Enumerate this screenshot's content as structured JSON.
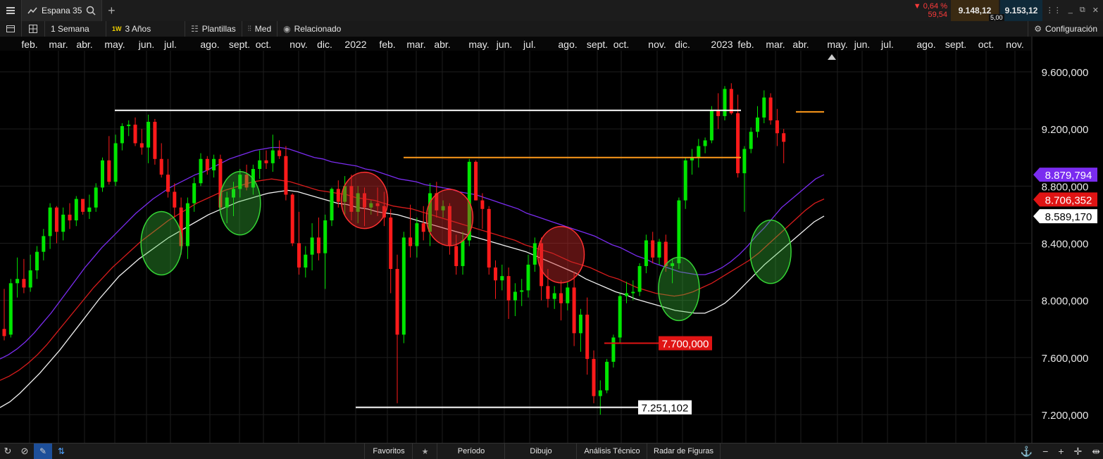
{
  "topbar": {
    "instrument": "Espana 35",
    "change_pct": "▼ 0,64 %",
    "change_pts": "59,54",
    "bid": "9.148,12",
    "ask": "9.153,12",
    "spread": "5,00"
  },
  "toolbar": {
    "interval": "1 Semana",
    "interval_badge": "1W",
    "range": "3 Años",
    "templates": "Plantillas",
    "price_type": "Med",
    "related": "Relacionado",
    "config": "Configuración"
  },
  "bottombar": {
    "favorites": "Favoritos",
    "period": "Período",
    "drawing": "Dibujo",
    "technical": "Análisis Técnico",
    "patterns": "Radar de Figuras"
  },
  "colors": {
    "up": "#00e600",
    "down": "#ff1a1a",
    "ma_fast": "#7a2cf0",
    "ma_mid": "#d81c1c",
    "ma_slow": "#f2f2f2",
    "accent_orange": "#ff9a1a"
  },
  "chart_data": {
    "type": "candlestick",
    "instrument": "Espana 35",
    "interval": "weekly",
    "x_tick_labels": [
      "feb.",
      "mar.",
      "abr.",
      "may.",
      "jun.",
      "jul.",
      "ago.",
      "sept.",
      "oct.",
      "nov.",
      "dic.",
      "2022",
      "feb.",
      "mar.",
      "abr.",
      "may.",
      "jun.",
      "jul.",
      "ago.",
      "sept.",
      "oct.",
      "nov.",
      "dic.",
      "2023",
      "feb.",
      "mar.",
      "abr.",
      "may.",
      "jun.",
      "jul.",
      "ago.",
      "sept.",
      "oct.",
      "nov."
    ],
    "y_ticks": [
      "9.600,000",
      "9.200,000",
      "8.800,000",
      "8.400,000",
      "8.000,000",
      "7.600,000",
      "7.200,000"
    ],
    "y_tick_values": [
      9600,
      9200,
      8800,
      8400,
      8000,
      7600,
      7200
    ],
    "ylim": [
      7100,
      9800
    ],
    "grid": true,
    "candles": [
      [
        7800,
        8080,
        7720,
        7750
      ],
      [
        7760,
        8150,
        7740,
        8120
      ],
      [
        8120,
        8300,
        8020,
        8150
      ],
      [
        8150,
        8290,
        8050,
        8090
      ],
      [
        8090,
        8320,
        8060,
        8210
      ],
      [
        8210,
        8380,
        8150,
        8340
      ],
      [
        8340,
        8500,
        8280,
        8450
      ],
      [
        8450,
        8680,
        8360,
        8650
      ],
      [
        8650,
        8660,
        8400,
        8480
      ],
      [
        8480,
        8650,
        8420,
        8600
      ],
      [
        8600,
        8680,
        8500,
        8560
      ],
      [
        8560,
        8730,
        8520,
        8710
      ],
      [
        8710,
        8660,
        8600,
        8620
      ],
      [
        8620,
        8740,
        8570,
        8650
      ],
      [
        8650,
        8820,
        8620,
        8790
      ],
      [
        8790,
        9000,
        8760,
        8980
      ],
      [
        8980,
        9150,
        8810,
        8830
      ],
      [
        8830,
        9160,
        8800,
        9100
      ],
      [
        9100,
        9240,
        9050,
        9220
      ],
      [
        9220,
        9260,
        9150,
        9230
      ],
      [
        9230,
        9280,
        9080,
        9100
      ],
      [
        9100,
        9200,
        9020,
        9070
      ],
      [
        9070,
        9300,
        8960,
        9250
      ],
      [
        9250,
        9270,
        8950,
        8990
      ],
      [
        8990,
        9100,
        8860,
        8880
      ],
      [
        8880,
        8990,
        8720,
        8760
      ],
      [
        8760,
        8820,
        8580,
        8650
      ],
      [
        8650,
        8720,
        8320,
        8380
      ],
      [
        8380,
        8720,
        8290,
        8680
      ],
      [
        8680,
        8860,
        8620,
        8820
      ],
      [
        8820,
        9030,
        8800,
        8990
      ],
      [
        8990,
        9010,
        8880,
        8910
      ],
      [
        8910,
        9020,
        8860,
        8990
      ],
      [
        8990,
        9020,
        8620,
        8650
      ],
      [
        8650,
        8760,
        8540,
        8720
      ],
      [
        8720,
        8830,
        8590,
        8780
      ],
      [
        8780,
        8920,
        8720,
        8880
      ],
      [
        8880,
        8950,
        8770,
        8790
      ],
      [
        8790,
        8950,
        8740,
        8920
      ],
      [
        8920,
        9050,
        8850,
        8980
      ],
      [
        8980,
        9050,
        8920,
        8960
      ],
      [
        8960,
        9160,
        8900,
        9050
      ],
      [
        9050,
        9120,
        8990,
        9010
      ],
      [
        9010,
        9080,
        8700,
        8740
      ],
      [
        8740,
        8750,
        8380,
        8400
      ],
      [
        8400,
        8620,
        8180,
        8230
      ],
      [
        8230,
        8380,
        8160,
        8320
      ],
      [
        8320,
        8540,
        8210,
        8440
      ],
      [
        8440,
        8580,
        8280,
        8330
      ],
      [
        8330,
        8600,
        8080,
        8560
      ],
      [
        8560,
        8790,
        8520,
        8780
      ],
      [
        8780,
        8840,
        8650,
        8690
      ],
      [
        8690,
        8870,
        8600,
        8800
      ],
      [
        8800,
        8880,
        8560,
        8620
      ],
      [
        8620,
        8800,
        8540,
        8750
      ],
      [
        8750,
        8790,
        8520,
        8650
      ],
      [
        8650,
        8700,
        8600,
        8680
      ],
      [
        8680,
        8790,
        8590,
        8660
      ],
      [
        8660,
        8760,
        8520,
        8580
      ],
      [
        8580,
        8640,
        8050,
        8220
      ],
      [
        8220,
        8320,
        7280,
        7760
      ],
      [
        7760,
        8480,
        7700,
        8440
      ],
      [
        8440,
        8670,
        8300,
        8380
      ],
      [
        8380,
        8580,
        8300,
        8540
      ],
      [
        8540,
        8660,
        8420,
        8480
      ],
      [
        8480,
        8820,
        8380,
        8750
      ],
      [
        8750,
        8830,
        8580,
        8630
      ],
      [
        8630,
        8700,
        8580,
        8660
      ],
      [
        8660,
        8680,
        8320,
        8380
      ],
      [
        8380,
        8460,
        8180,
        8240
      ],
      [
        8240,
        8480,
        8180,
        8420
      ],
      [
        8420,
        8990,
        8380,
        8970
      ],
      [
        8970,
        8980,
        8700,
        8700
      ],
      [
        8700,
        8750,
        8500,
        8640
      ],
      [
        8640,
        8660,
        8180,
        8230
      ],
      [
        8230,
        8280,
        8010,
        8140
      ],
      [
        8140,
        8250,
        8070,
        8170
      ],
      [
        8170,
        8230,
        7870,
        8000
      ],
      [
        8000,
        8120,
        7890,
        8060
      ],
      [
        8060,
        8150,
        7960,
        8070
      ],
      [
        8070,
        8320,
        8020,
        8250
      ],
      [
        8250,
        8440,
        8200,
        8400
      ],
      [
        8400,
        8440,
        8000,
        8100
      ],
      [
        8100,
        8220,
        7950,
        8010
      ],
      [
        8010,
        8100,
        7940,
        8050
      ],
      [
        8050,
        8140,
        7860,
        7980
      ],
      [
        7980,
        8130,
        7930,
        8090
      ],
      [
        8090,
        8200,
        7680,
        7770
      ],
      [
        7770,
        7940,
        7640,
        7900
      ],
      [
        7900,
        8020,
        7480,
        7590
      ],
      [
        7590,
        7650,
        7280,
        7330
      ],
      [
        7330,
        7440,
        7200,
        7370
      ],
      [
        7370,
        7590,
        7350,
        7570
      ],
      [
        7570,
        7760,
        7530,
        7740
      ],
      [
        7740,
        8050,
        7700,
        8030
      ],
      [
        8030,
        8130,
        7980,
        8050
      ],
      [
        8050,
        8140,
        8000,
        8060
      ],
      [
        8060,
        8260,
        8030,
        8240
      ],
      [
        8240,
        8460,
        8190,
        8420
      ],
      [
        8420,
        8480,
        8260,
        8300
      ],
      [
        8300,
        8430,
        8250,
        8410
      ],
      [
        8410,
        8460,
        8200,
        8240
      ],
      [
        8240,
        8290,
        8120,
        8260
      ],
      [
        8260,
        8720,
        8220,
        8700
      ],
      [
        8700,
        9000,
        8640,
        8980
      ],
      [
        8980,
        9060,
        8880,
        9000
      ],
      [
        9000,
        9130,
        8930,
        9080
      ],
      [
        9080,
        9140,
        9030,
        9120
      ],
      [
        9120,
        9360,
        9100,
        9330
      ],
      [
        9330,
        9450,
        9200,
        9290
      ],
      [
        9290,
        9500,
        9260,
        9480
      ],
      [
        9480,
        9520,
        9300,
        9310
      ],
      [
        9310,
        9440,
        8860,
        8890
      ],
      [
        8890,
        9080,
        8620,
        9060
      ],
      [
        9060,
        9210,
        9030,
        9180
      ],
      [
        9180,
        9360,
        9140,
        9280
      ],
      [
        9280,
        9470,
        9240,
        9420
      ],
      [
        9420,
        9450,
        9230,
        9260
      ],
      [
        9260,
        9340,
        9080,
        9170
      ],
      [
        9170,
        9200,
        8960,
        9110
      ]
    ],
    "moving_averages": [
      {
        "color": "#7a2cf0",
        "values": [
          7590,
          7620,
          7660,
          7710,
          7770,
          7840,
          7910,
          7990,
          8070,
          8150,
          8230,
          8300,
          8370,
          8430,
          8490,
          8550,
          8610,
          8660,
          8710,
          8750,
          8790,
          8820,
          8850,
          8880,
          8900,
          8930,
          8960,
          8990,
          9010,
          9030,
          9050,
          9060,
          9070,
          9070,
          9060,
          9040,
          9020,
          9000,
          8990,
          8970,
          8960,
          8950,
          8940,
          8920,
          8910,
          8890,
          8870,
          8850,
          8840,
          8830,
          8810,
          8800,
          8790,
          8780,
          8760,
          8750,
          8740,
          8720,
          8700,
          8680,
          8660,
          8640,
          8610,
          8590,
          8570,
          8550,
          8530,
          8510,
          8490,
          8470,
          8450,
          8420,
          8390,
          8370,
          8340,
          8310,
          8290,
          8260,
          8240,
          8220,
          8200,
          8190,
          8180,
          8180,
          8200,
          8230,
          8270,
          8320,
          8380,
          8450,
          8510,
          8580,
          8650,
          8700,
          8750,
          8800,
          8850,
          8880
        ]
      },
      {
        "color": "#d81c1c",
        "values": [
          7440,
          7470,
          7510,
          7560,
          7620,
          7690,
          7770,
          7850,
          7930,
          8010,
          8090,
          8160,
          8230,
          8290,
          8350,
          8410,
          8460,
          8510,
          8560,
          8600,
          8640,
          8680,
          8710,
          8740,
          8770,
          8790,
          8810,
          8830,
          8840,
          8850,
          8840,
          8830,
          8810,
          8790,
          8770,
          8760,
          8750,
          8740,
          8720,
          8710,
          8700,
          8680,
          8660,
          8650,
          8640,
          8620,
          8600,
          8580,
          8560,
          8540,
          8520,
          8500,
          8480,
          8460,
          8440,
          8420,
          8390,
          8370,
          8350,
          8330,
          8300,
          8270,
          8250,
          8230,
          8200,
          8170,
          8150,
          8120,
          8090,
          8070,
          8050,
          8040,
          8030,
          8040,
          8060,
          8090,
          8120,
          8160,
          8200,
          8240,
          8280,
          8330,
          8390,
          8450,
          8510,
          8570,
          8630,
          8680,
          8710
        ]
      },
      {
        "color": "#f2f2f2",
        "values": [
          7250,
          7290,
          7350,
          7420,
          7490,
          7570,
          7650,
          7740,
          7830,
          7920,
          8010,
          8090,
          8170,
          8230,
          8290,
          8340,
          8390,
          8440,
          8480,
          8520,
          8560,
          8600,
          8630,
          8660,
          8690,
          8710,
          8730,
          8750,
          8760,
          8770,
          8760,
          8740,
          8720,
          8700,
          8680,
          8670,
          8650,
          8640,
          8620,
          8610,
          8600,
          8580,
          8560,
          8540,
          8520,
          8500,
          8480,
          8460,
          8440,
          8420,
          8400,
          8380,
          8360,
          8340,
          8310,
          8280,
          8250,
          8220,
          8190,
          8150,
          8120,
          8090,
          8060,
          8040,
          8010,
          7990,
          7970,
          7950,
          7930,
          7920,
          7910,
          7910,
          7940,
          7980,
          8040,
          8110,
          8180,
          8250,
          8310,
          8370,
          8430,
          8490,
          8550,
          8590
        ]
      }
    ],
    "annotations": {
      "resistance_white": 9330,
      "resistance_orange": 9000,
      "support_low": 7251.102,
      "support_low_label": "7.251,102",
      "level_mid": 7700,
      "level_mid_label": "7.700,000",
      "recent_orange": 9320
    },
    "price_tags": [
      {
        "label": "8.879,794",
        "value": 8879.794,
        "bg": "#7a2cf0",
        "fg": "#ffffff"
      },
      {
        "label": "8.706,352",
        "value": 8706.352,
        "bg": "#e01414",
        "fg": "#ffffff"
      },
      {
        "label": "8.589,170",
        "value": 8589.17,
        "bg": "#ffffff",
        "fg": "#000000"
      }
    ],
    "circles": [
      {
        "color": "green",
        "candle": 24,
        "value": 8400
      },
      {
        "color": "green",
        "candle": 36,
        "value": 8680
      },
      {
        "color": "red",
        "candle": 55,
        "value": 8700
      },
      {
        "color": "red",
        "candle": 68,
        "value": 8580
      },
      {
        "color": "red",
        "candle": 85,
        "value": 8320
      },
      {
        "color": "green",
        "candle": 103,
        "value": 8080
      },
      {
        "color": "green",
        "candle": 117,
        "value": 8340
      }
    ]
  }
}
